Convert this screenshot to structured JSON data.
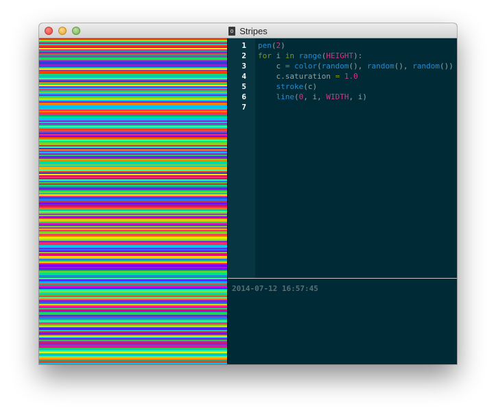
{
  "window": {
    "title": "Stripes",
    "controls": [
      "close",
      "minimize",
      "zoom"
    ]
  },
  "canvas": {
    "description_icon": "stripes-canvas",
    "palette": [
      "#c0392b",
      "#e74c3c",
      "#ff2a6d",
      "#8e44ad",
      "#9b1fd1",
      "#6c2bd9",
      "#2d3ed6",
      "#1f78ff",
      "#00bfff",
      "#00d1d1",
      "#1abc9c",
      "#16a085",
      "#2ecc40",
      "#7fd321",
      "#c7e600",
      "#ffe600",
      "#ffb000",
      "#ff7a00",
      "#ff3d00",
      "#d4145a",
      "#ff00aa",
      "#7a00ff",
      "#00e676",
      "#33ff99"
    ]
  },
  "editor": {
    "lines": [
      {
        "num": "1",
        "tokens": [
          {
            "t": "pen",
            "c": "#268bd2"
          },
          {
            "t": "(",
            "c": "#93a1a1"
          },
          {
            "t": "2",
            "c": "#d33682"
          },
          {
            "t": ")",
            "c": "#93a1a1"
          }
        ]
      },
      {
        "num": "2",
        "tokens": [
          {
            "t": "for",
            "c": "#859900"
          },
          {
            "t": " i ",
            "c": "#93a1a1"
          },
          {
            "t": "in",
            "c": "#859900"
          },
          {
            "t": " ",
            "c": "#93a1a1"
          },
          {
            "t": "range",
            "c": "#268bd2"
          },
          {
            "t": "(",
            "c": "#93a1a1"
          },
          {
            "t": "HEIGHT",
            "c": "#d33682"
          },
          {
            "t": "):",
            "c": "#93a1a1"
          }
        ]
      },
      {
        "num": "3",
        "tokens": [
          {
            "t": "    c ",
            "c": "#93a1a1"
          },
          {
            "t": "=",
            "c": "#859900"
          },
          {
            "t": " ",
            "c": "#93a1a1"
          },
          {
            "t": "color",
            "c": "#268bd2"
          },
          {
            "t": "(",
            "c": "#93a1a1"
          },
          {
            "t": "random",
            "c": "#268bd2"
          },
          {
            "t": "(), ",
            "c": "#93a1a1"
          },
          {
            "t": "random",
            "c": "#268bd2"
          },
          {
            "t": "(), ",
            "c": "#93a1a1"
          },
          {
            "t": "random",
            "c": "#268bd2"
          },
          {
            "t": "())",
            "c": "#93a1a1"
          }
        ]
      },
      {
        "num": "4",
        "tokens": [
          {
            "t": "    c.saturation ",
            "c": "#93a1a1"
          },
          {
            "t": "=",
            "c": "#859900"
          },
          {
            "t": " ",
            "c": "#93a1a1"
          },
          {
            "t": "1.0",
            "c": "#d33682"
          }
        ]
      },
      {
        "num": "5",
        "tokens": [
          {
            "t": "    ",
            "c": "#93a1a1"
          },
          {
            "t": "stroke",
            "c": "#268bd2"
          },
          {
            "t": "(c)",
            "c": "#93a1a1"
          }
        ]
      },
      {
        "num": "6",
        "tokens": [
          {
            "t": "    ",
            "c": "#93a1a1"
          },
          {
            "t": "line",
            "c": "#268bd2"
          },
          {
            "t": "(",
            "c": "#93a1a1"
          },
          {
            "t": "0",
            "c": "#d33682"
          },
          {
            "t": ", i, ",
            "c": "#93a1a1"
          },
          {
            "t": "WIDTH",
            "c": "#d33682"
          },
          {
            "t": ", i)",
            "c": "#93a1a1"
          }
        ]
      },
      {
        "num": "7",
        "tokens": []
      }
    ]
  },
  "console": {
    "timestamp": "2014-07-12 16:57:45"
  },
  "colors": {
    "editor_bg": "#002b36",
    "gutter_bg": "#073642",
    "keyword": "#859900",
    "function": "#268bd2",
    "constant": "#d33682"
  }
}
